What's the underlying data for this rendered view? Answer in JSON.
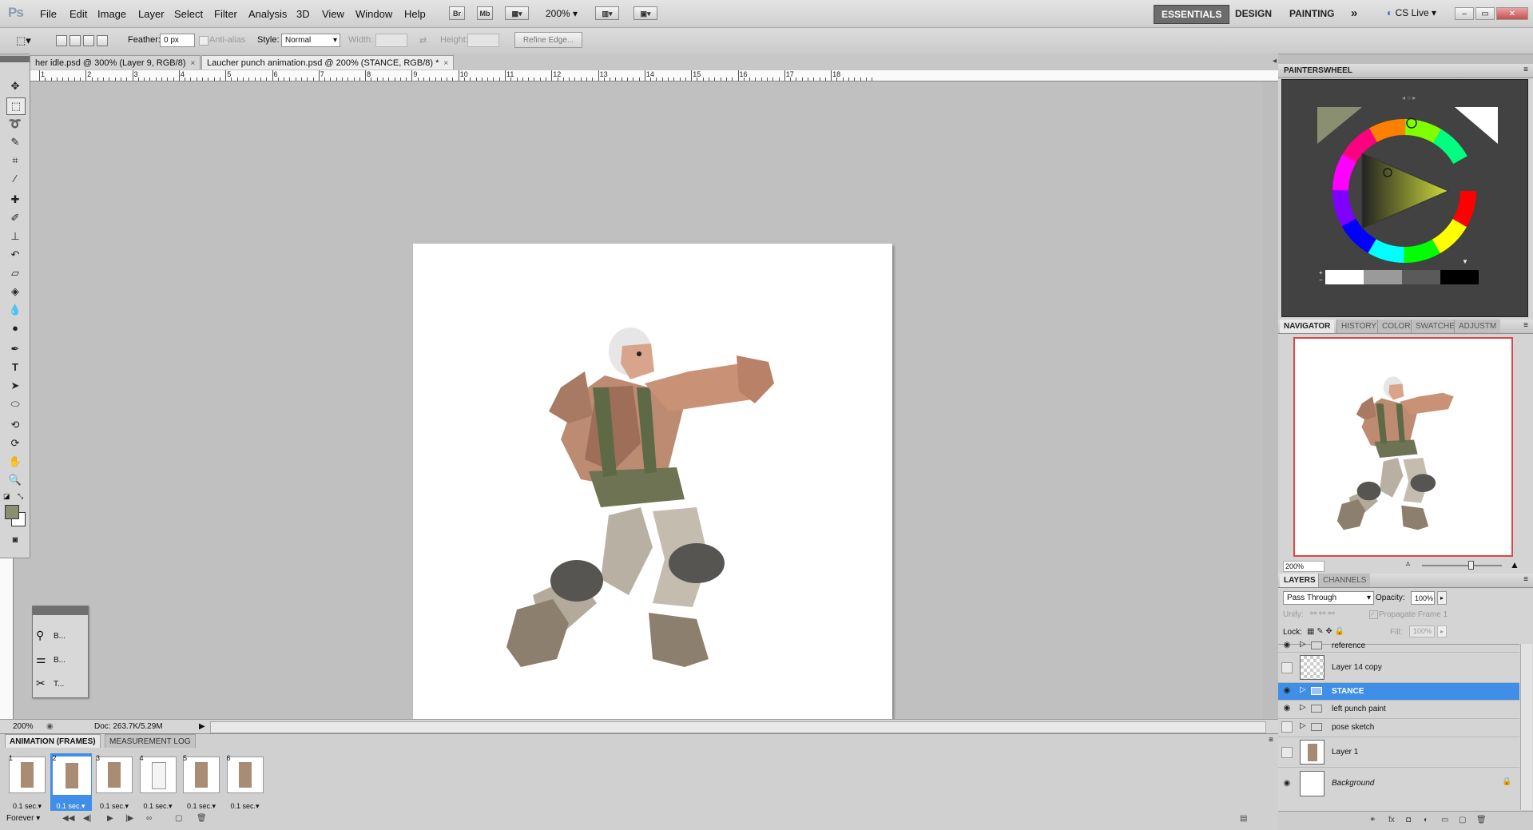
{
  "app": {
    "logo": "Ps"
  },
  "menu": [
    "File",
    "Edit",
    "Image",
    "Layer",
    "Select",
    "Filter",
    "Analysis",
    "3D",
    "View",
    "Window",
    "Help"
  ],
  "menubar_icons": {
    "bridge": "Br",
    "minibridge": "Mb"
  },
  "zoom_dropdown": "200%",
  "workspaces": {
    "essentials": "ESSENTIALS",
    "design": "DESIGN",
    "painting": "PAINTING",
    "more": "»"
  },
  "cslive": "CS Live",
  "window_controls": {
    "minimize": "–",
    "restore": "▭",
    "close": "✕"
  },
  "options": {
    "feather_label": "Feather:",
    "feather_value": "0 px",
    "antialias_label": "Anti-alias",
    "style_label": "Style:",
    "style_value": "Normal",
    "width_label": "Width:",
    "height_label": "Height:",
    "refine_edge": "Refine Edge..."
  },
  "doc_tabs": [
    {
      "label": "her idle.psd @ 300% (Layer 9, RGB/8)",
      "close": "×"
    },
    {
      "label": "Laucher punch animation.psd @ 200% (STANCE, RGB/8) *",
      "close": "×"
    }
  ],
  "ruler_numbers": [
    "1",
    "2",
    "3",
    "4",
    "5",
    "6",
    "7",
    "8",
    "9",
    "10",
    "11",
    "12",
    "13",
    "14",
    "15",
    "16",
    "17",
    "18"
  ],
  "status": {
    "zoom": "200%",
    "doc": "Doc: 263.7K/5.29M"
  },
  "animation": {
    "tabs": [
      "ANIMATION (FRAMES)",
      "MEASUREMENT LOG"
    ],
    "frames": [
      {
        "num": "1",
        "delay": "0.1 sec."
      },
      {
        "num": "2",
        "delay": "0.1 sec."
      },
      {
        "num": "3",
        "delay": "0.1 sec."
      },
      {
        "num": "4",
        "delay": "0.1 sec."
      },
      {
        "num": "5",
        "delay": "0.1 sec."
      },
      {
        "num": "6",
        "delay": "0.1 sec."
      }
    ],
    "loop": "Forever"
  },
  "mini_panel": {
    "items": [
      "B...",
      "B...",
      "T..."
    ]
  },
  "painterswheel": {
    "title": "PAINTERSWHEEL"
  },
  "navigator": {
    "tabs": [
      "NAVIGATOR",
      "HISTORY",
      "COLOR",
      "SWATCHE",
      "ADJUSTM"
    ],
    "zoom": "200%"
  },
  "layers": {
    "tabs": [
      "LAYERS",
      "CHANNELS"
    ],
    "blend_mode": "Pass Through",
    "opacity_label": "Opacity:",
    "opacity": "100%",
    "unify_label": "Unify:",
    "propagate": "Propagate Frame 1",
    "lock_label": "Lock:",
    "fill_label": "Fill:",
    "fill": "100%",
    "rows": [
      {
        "name": "reference",
        "type": "group",
        "visible": true
      },
      {
        "name": "Layer 14 copy",
        "type": "layer",
        "visible": false
      },
      {
        "name": "STANCE",
        "type": "group",
        "visible": true,
        "selected": true
      },
      {
        "name": "left punch paint",
        "type": "group",
        "visible": true
      },
      {
        "name": "pose sketch",
        "type": "group",
        "visible": false
      },
      {
        "name": "Layer 1",
        "type": "layer",
        "visible": false
      },
      {
        "name": "Background",
        "type": "background",
        "visible": true
      }
    ]
  },
  "colors": {
    "accent": "#3f8ee8",
    "fg_swatch": "#8b8f72",
    "nav_border": "#e04545"
  }
}
